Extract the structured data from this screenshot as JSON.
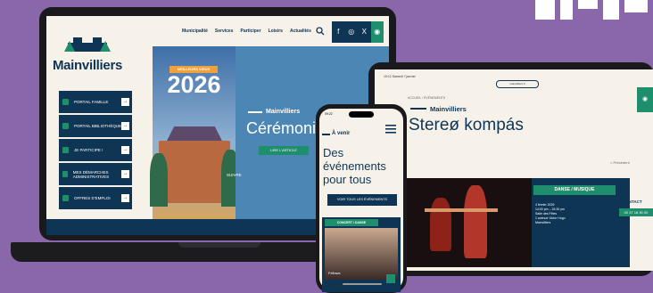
{
  "colors": {
    "background": "#8a66aa",
    "navy": "#0f3555",
    "green": "#1f8e6d",
    "cream": "#f6f2e9",
    "badge_orange": "#f0a13a"
  },
  "laptop": {
    "brand": "Mainvilliers",
    "nav": [
      "Municipalité",
      "Services",
      "Participer",
      "Loisirs",
      "Actualités"
    ],
    "search_icon": "search-icon",
    "social": [
      "f",
      "◎",
      "X",
      "◉"
    ],
    "sidebar": [
      {
        "label": "PORTAIL FAMILLE",
        "icon": "family-icon"
      },
      {
        "label": "PORTAIL BIBLIOTHÈQUE",
        "icon": "book-icon"
      },
      {
        "label": "JE PARTICIPE !",
        "icon": "hand-icon"
      },
      {
        "label": "MES DÉMARCHES ADMINISTRATIVES",
        "icon": "document-icon"
      },
      {
        "label": "OFFRES D'EMPLOI",
        "icon": "search-icon"
      }
    ],
    "hero": {
      "badge": "MEILLEURS VŒUX",
      "year": "2026",
      "brand": "Mainvilliers",
      "title": "Cérémonie",
      "button": "LIRE L'ARTICLE",
      "follow": "SUIVRE"
    }
  },
  "tablet": {
    "time": "10:12  Samedi 7 janvier",
    "url": "mainvilliers.fr",
    "crumb": "ACCUEIL / ÉVÉNEMENTS",
    "brand": "Mainvilliers",
    "title": "Stereø kompás",
    "previous": "< Précédent",
    "tag": "DANSE / MUSIQUE",
    "details": [
      "4 février 2026",
      "14:00 pm – 15:30 pm",
      "Salle des Fêtes",
      "1 avenue Victor Hugo",
      "Mainvilliers"
    ],
    "contact_label": "CONTACT",
    "phone": "02 37 18 30 00"
  },
  "phone": {
    "time": "09:22",
    "section": "À venir",
    "title": "Des événements pour tous",
    "button": "VOIR TOUS LES ÉVÉNEMENTS",
    "card_tag": "CONCERT / DANSE",
    "card_caption": "Fellows",
    "url": "mainvilliers.fr"
  }
}
